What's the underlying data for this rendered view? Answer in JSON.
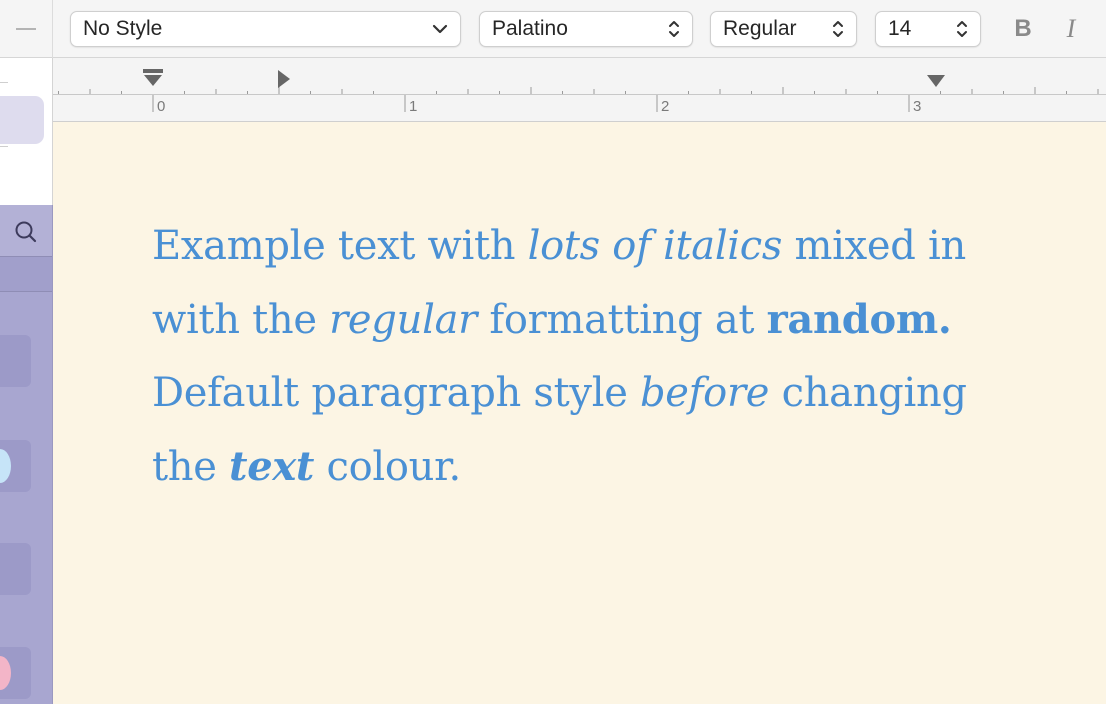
{
  "toolbar": {
    "paragraph_style": "No Style",
    "font_family": "Palatino",
    "typeface": "Regular",
    "font_size": "14",
    "bold_label": "B",
    "italic_label": "I"
  },
  "ruler": {
    "numbers": [
      "0",
      "1",
      "2",
      "3"
    ]
  },
  "document": {
    "runs": [
      {
        "text": "Example text with ",
        "style": "regular"
      },
      {
        "text": "lots of italics",
        "style": "italic"
      },
      {
        "text": " mixed in with the ",
        "style": "regular"
      },
      {
        "text": "regular",
        "style": "italic"
      },
      {
        "text": " formatting at ",
        "style": "regular"
      },
      {
        "text": "random.",
        "style": "bold"
      },
      {
        "text": " Default paragraph style ",
        "style": "regular"
      },
      {
        "text": "before",
        "style": "italic"
      },
      {
        "text": " changing the ",
        "style": "regular"
      },
      {
        "text": "text",
        "style": "bold-italic"
      },
      {
        "text": " colour.",
        "style": "regular"
      }
    ]
  },
  "colors": {
    "text_color": "#4a90d4",
    "document_background": "#fcf5e4",
    "sidebar_background": "#a8a6d0"
  }
}
